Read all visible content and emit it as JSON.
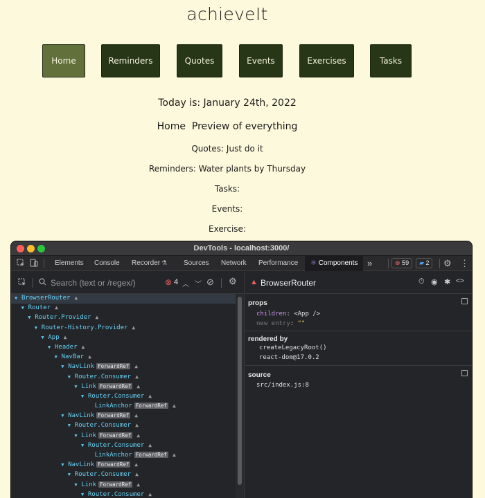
{
  "app": {
    "title": "achieveIt",
    "nav": [
      "Home",
      "Reminders",
      "Quotes",
      "Events",
      "Exercises",
      "Tasks"
    ],
    "today": "Today is: January 24th, 2022",
    "heading": "Home  Preview of everything",
    "quotes": "Quotes: Just do it",
    "reminders": "Reminders: Water plants by Thursday",
    "tasks": "Tasks:",
    "events": "Events:",
    "exercise": "Exercise:"
  },
  "devtools": {
    "title": "DevTools - localhost:3000/",
    "tabs": [
      "Elements",
      "Console",
      "Recorder",
      "Sources",
      "Network",
      "Performance",
      "Components"
    ],
    "more": "»",
    "errors": "59",
    "messages": "2",
    "search_placeholder": "Search (text or /regex/)",
    "search_errors": "4",
    "selected_component": "BrowserRouter",
    "props_title": "props",
    "props": {
      "children_key": "children",
      "children_value": "<App />",
      "new_entry_key": "new entry",
      "new_entry_value": "\"\""
    },
    "rendered_by_title": "rendered by",
    "rendered_by": [
      "createLegacyRoot()",
      "react-dom@17.0.2"
    ],
    "source_title": "source",
    "source": "src/index.js:8",
    "forward_ref": "ForwardRef",
    "tree": [
      {
        "name": "BrowserRouter",
        "depth": 0,
        "fr": false,
        "sel": true
      },
      {
        "name": "Router",
        "depth": 1,
        "fr": false
      },
      {
        "name": "Router.Provider",
        "depth": 2,
        "fr": false
      },
      {
        "name": "Router-History.Provider",
        "depth": 3,
        "fr": false
      },
      {
        "name": "App",
        "depth": 4,
        "fr": false
      },
      {
        "name": "Header",
        "depth": 5,
        "fr": false
      },
      {
        "name": "NavBar",
        "depth": 6,
        "fr": false
      },
      {
        "name": "NavLink",
        "depth": 7,
        "fr": true
      },
      {
        "name": "Router.Consumer",
        "depth": 8,
        "fr": false
      },
      {
        "name": "Link",
        "depth": 9,
        "fr": true
      },
      {
        "name": "Router.Consumer",
        "depth": 10,
        "fr": false
      },
      {
        "name": "LinkAnchor",
        "depth": 11,
        "fr": true,
        "leaf": true
      },
      {
        "name": "NavLink",
        "depth": 7,
        "fr": true
      },
      {
        "name": "Router.Consumer",
        "depth": 8,
        "fr": false
      },
      {
        "name": "Link",
        "depth": 9,
        "fr": true
      },
      {
        "name": "Router.Consumer",
        "depth": 10,
        "fr": false
      },
      {
        "name": "LinkAnchor",
        "depth": 11,
        "fr": true,
        "leaf": true
      },
      {
        "name": "NavLink",
        "depth": 7,
        "fr": true
      },
      {
        "name": "Router.Consumer",
        "depth": 8,
        "fr": false
      },
      {
        "name": "Link",
        "depth": 9,
        "fr": true
      },
      {
        "name": "Router.Consumer",
        "depth": 10,
        "fr": false
      }
    ]
  }
}
